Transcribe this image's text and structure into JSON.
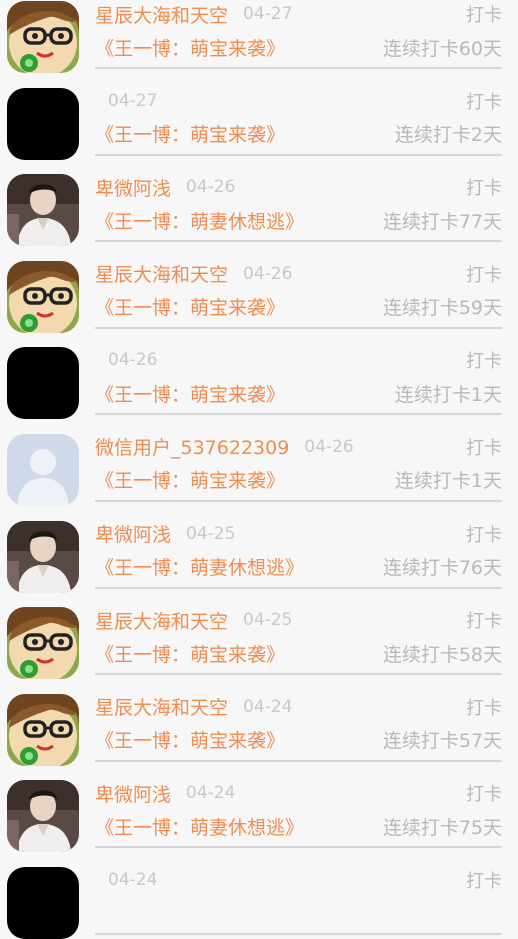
{
  "feed": {
    "items": [
      {
        "avatar_icon": "cartoon-boy-glasses-icon",
        "name": "星辰大海和天空",
        "date": "04-27",
        "action": "打卡",
        "title": "《王一博：萌宝来袭》",
        "streak": "连续打卡60天"
      },
      {
        "avatar_icon": "black-avatar-icon",
        "name": "",
        "date": "04-27",
        "action": "打卡",
        "title": "《王一博：萌宝来袭》",
        "streak": "连续打卡2天"
      },
      {
        "avatar_icon": "photo-person-icon",
        "name": "卑微阿浅",
        "date": "04-26",
        "action": "打卡",
        "title": "《王一博：萌妻休想逃》",
        "streak": "连续打卡77天"
      },
      {
        "avatar_icon": "cartoon-boy-glasses-icon",
        "name": "星辰大海和天空",
        "date": "04-26",
        "action": "打卡",
        "title": "《王一博：萌宝来袭》",
        "streak": "连续打卡59天"
      },
      {
        "avatar_icon": "black-avatar-icon",
        "name": "",
        "date": "04-26",
        "action": "打卡",
        "title": "《王一博：萌宝来袭》",
        "streak": "连续打卡1天"
      },
      {
        "avatar_icon": "default-user-icon",
        "name": "微信用户_537622309",
        "date": "04-26",
        "action": "打卡",
        "title": "《王一博：萌宝来袭》",
        "streak": "连续打卡1天"
      },
      {
        "avatar_icon": "photo-person-icon",
        "name": "卑微阿浅",
        "date": "04-25",
        "action": "打卡",
        "title": "《王一博：萌妻休想逃》",
        "streak": "连续打卡76天"
      },
      {
        "avatar_icon": "cartoon-boy-glasses-icon",
        "name": "星辰大海和天空",
        "date": "04-25",
        "action": "打卡",
        "title": "《王一博：萌宝来袭》",
        "streak": "连续打卡58天"
      },
      {
        "avatar_icon": "cartoon-boy-glasses-icon",
        "name": "星辰大海和天空",
        "date": "04-24",
        "action": "打卡",
        "title": "《王一博：萌宝来袭》",
        "streak": "连续打卡57天"
      },
      {
        "avatar_icon": "photo-person-icon",
        "name": "卑微阿浅",
        "date": "04-24",
        "action": "打卡",
        "title": "《王一博：萌妻休想逃》",
        "streak": "连续打卡75天"
      },
      {
        "avatar_icon": "black-avatar-icon",
        "name": "",
        "date": "04-24",
        "action": "打卡",
        "title": "",
        "streak": ""
      }
    ]
  },
  "colors": {
    "accent": "#f08d52",
    "muted": "#b9b9b9",
    "date": "#c8c8c8",
    "background": "#f7f7f7"
  }
}
